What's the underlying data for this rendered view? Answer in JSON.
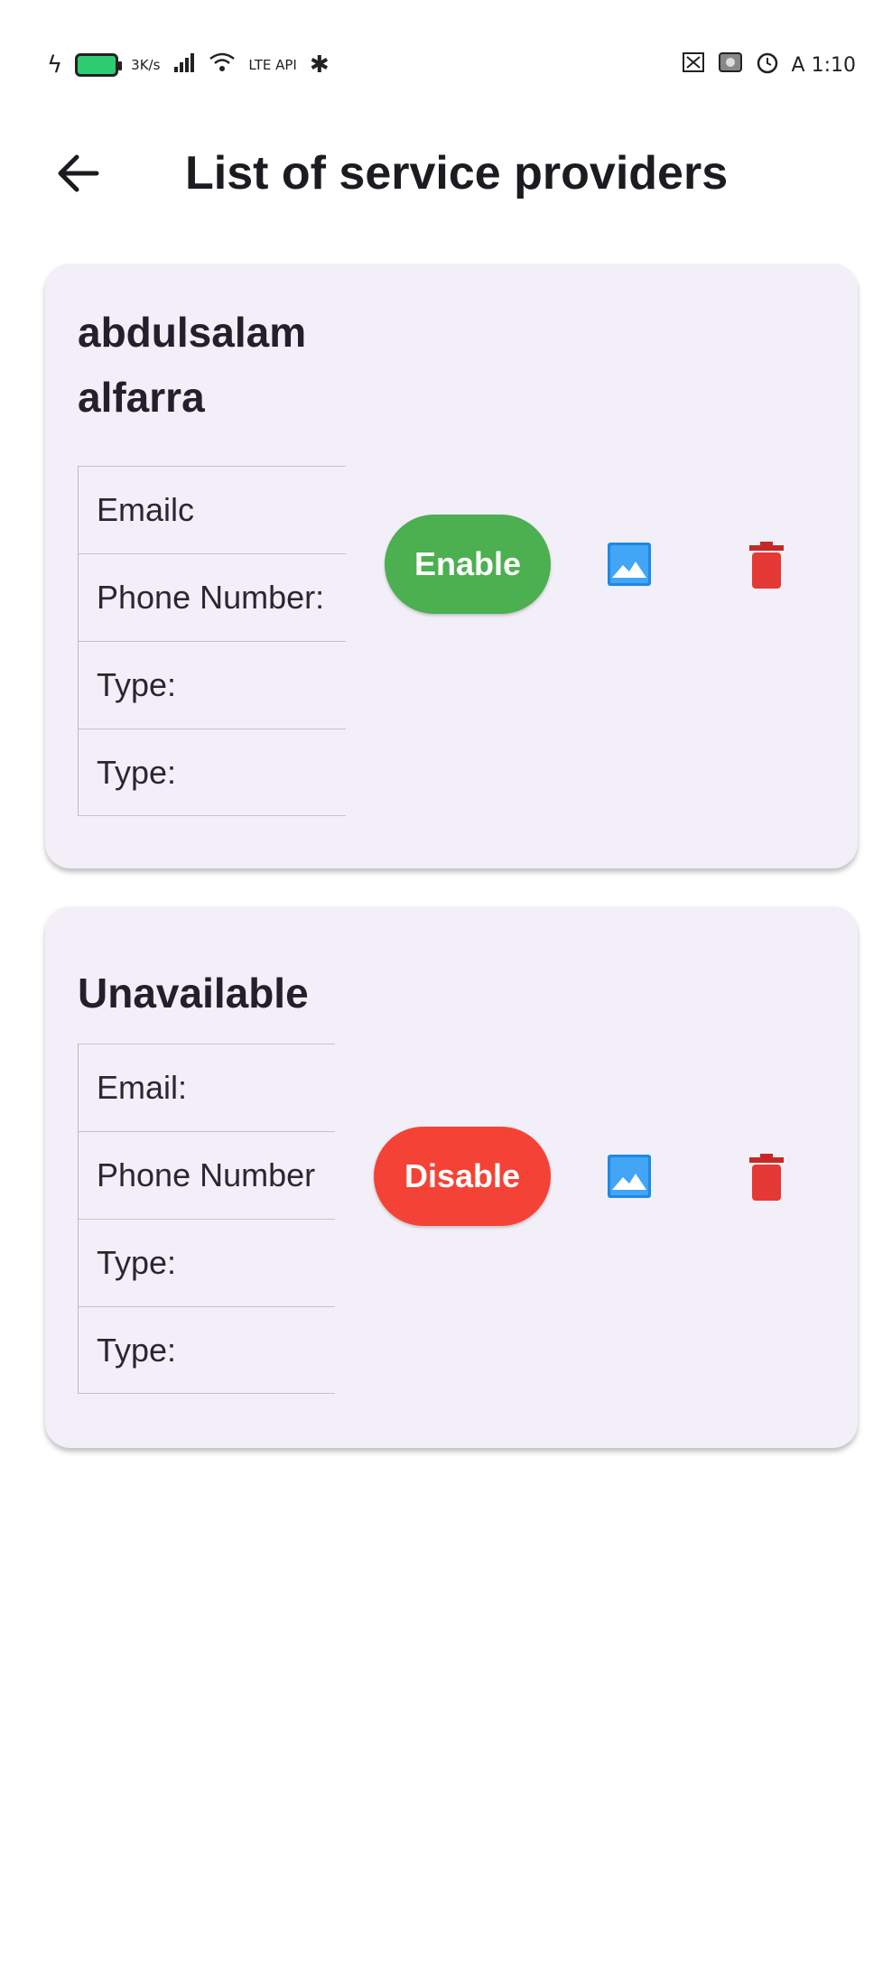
{
  "status_bar": {
    "left_text_1": "3K/s",
    "left_text_2": "LTE API",
    "right_text": "A 1:10",
    "icons": [
      "flash-icon",
      "battery-icon",
      "signal-icon",
      "wifi-icon",
      "bluetooth-icon",
      "nfc-icon",
      "screenshot-icon",
      "alarm-icon"
    ]
  },
  "app_bar": {
    "title": "List of service providers",
    "back_icon": "arrow-left-icon"
  },
  "providers": [
    {
      "name": "abdulsalam alfarra",
      "fields": [
        "Emailc",
        "Phone Number:",
        "Type:",
        "Type:"
      ],
      "status_button": "Enable",
      "status_color": "#4caf50"
    },
    {
      "name": "Unavailable",
      "fields": [
        "Email:",
        "Phone Number",
        "Type:",
        "Type:"
      ],
      "status_button": "Disable",
      "status_color": "#f44336"
    }
  ],
  "colors": {
    "card_background": "#f3eff8",
    "enable": "#4caf50",
    "disable": "#f44336",
    "image_icon": "#1e88e5",
    "delete_icon": "#e53935"
  }
}
